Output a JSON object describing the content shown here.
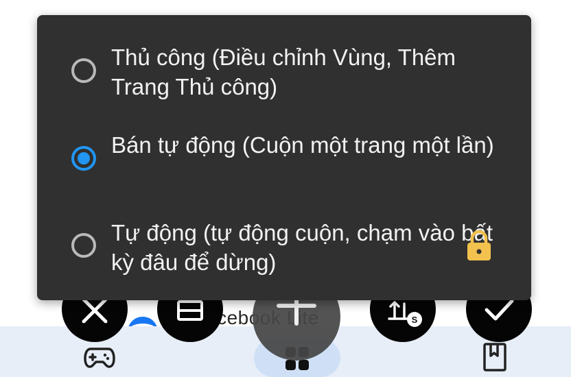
{
  "dialog": {
    "options": [
      {
        "label": "Thủ công (Điều chỉnh Vùng, Thêm Trang Thủ công)",
        "selected": false,
        "locked": false
      },
      {
        "label": "Bán tự động (Cuộn một trang một lần)",
        "selected": true,
        "locked": false
      },
      {
        "label": "Tự động (tự động cuộn, chạm vào bất kỳ đâu để dừng)",
        "selected": false,
        "locked": true
      }
    ]
  },
  "background": {
    "app_text": "acebook Lite"
  },
  "toolbar": {
    "buttons": [
      "close-icon",
      "crop-icon",
      "add-icon",
      "scroll-settings-icon",
      "check-icon"
    ]
  },
  "bottom_nav": {
    "items": [
      "gamepad-icon",
      "apps-grid-icon",
      "bookmark-icon"
    ]
  },
  "colors": {
    "dialog_bg": "#303030",
    "accent": "#2196f3",
    "lock": "#f2c14e",
    "nav_bg": "#e7eef8"
  }
}
